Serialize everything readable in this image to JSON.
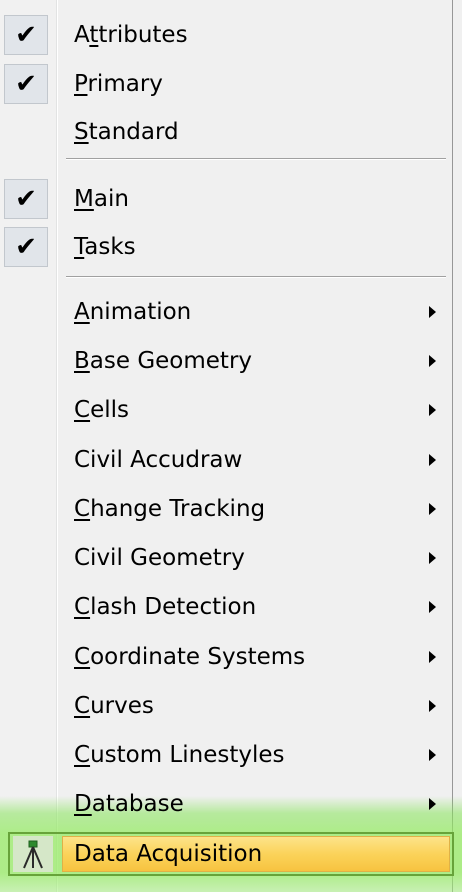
{
  "menu": {
    "checked_group_1": [
      {
        "label_pre": "A",
        "label_u": "t",
        "label_post": "tributes",
        "checked": true
      },
      {
        "label_pre": "",
        "label_u": "P",
        "label_post": "rimary",
        "checked": true
      },
      {
        "label_pre": "",
        "label_u": "S",
        "label_post": "tandard",
        "checked": false
      }
    ],
    "checked_group_2": [
      {
        "label_pre": "",
        "label_u": "M",
        "label_post": "ain",
        "checked": true
      },
      {
        "label_pre": "",
        "label_u": "T",
        "label_post": "asks",
        "checked": true
      }
    ],
    "submenus": [
      {
        "label_pre": "",
        "label_u": "A",
        "label_post": "nimation"
      },
      {
        "label_pre": "",
        "label_u": "B",
        "label_post": "ase Geometry"
      },
      {
        "label_pre": "",
        "label_u": "C",
        "label_post": "ells"
      },
      {
        "label_pre": "Civil Accudraw",
        "label_u": "",
        "label_post": ""
      },
      {
        "label_pre": "",
        "label_u": "C",
        "label_post": "hange Tracking"
      },
      {
        "label_pre": "Civil Geometry",
        "label_u": "",
        "label_post": ""
      },
      {
        "label_pre": "",
        "label_u": "C",
        "label_post": "lash Detection"
      },
      {
        "label_pre": "",
        "label_u": "C",
        "label_post": "oordinate Systems"
      },
      {
        "label_pre": "",
        "label_u": "C",
        "label_post": "urves"
      },
      {
        "label_pre": "",
        "label_u": "C",
        "label_post": "ustom Linestyles"
      },
      {
        "label_pre": "",
        "label_u": "D",
        "label_post": "atabase"
      }
    ],
    "highlighted": {
      "label": "Data Acquisition",
      "icon": "survey-tripod-icon"
    },
    "check_glyph": "✔",
    "colors": {
      "highlight": "#fbd35a",
      "glow": "#96eb64",
      "frame": "#67a33a"
    }
  }
}
